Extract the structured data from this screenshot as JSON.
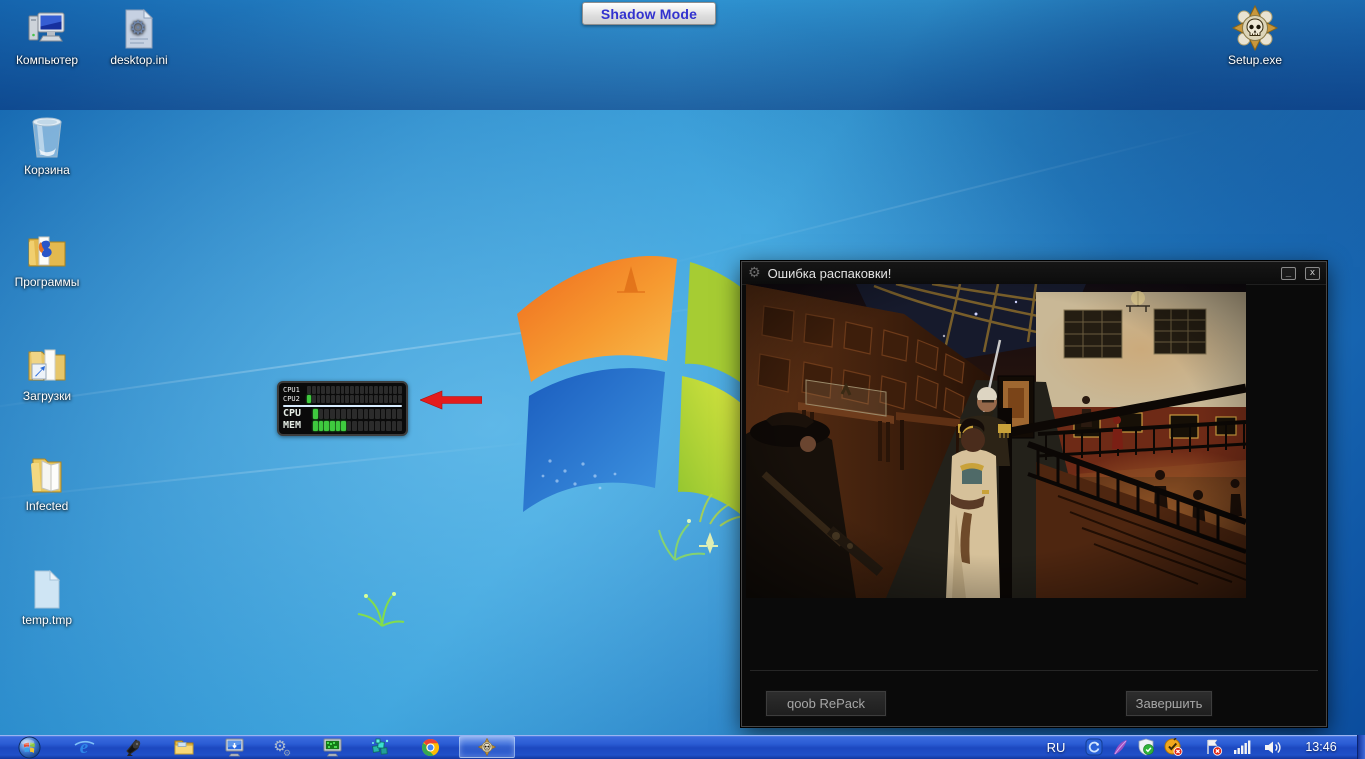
{
  "shadow_mode": {
    "label": "Shadow Mode",
    "text_color": "#3232cf"
  },
  "desktop_icons": [
    {
      "id": "computer",
      "label": "Компьютер",
      "icon": "computer-icon"
    },
    {
      "id": "desktop-ini",
      "label": "desktop.ini",
      "icon": "ini-file-gear-icon"
    },
    {
      "id": "recycle-bin",
      "label": "Корзина",
      "icon": "recycle-bin-icon"
    },
    {
      "id": "programs",
      "label": "Программы",
      "icon": "folder-programs-icon"
    },
    {
      "id": "downloads",
      "label": "Загрузки",
      "icon": "folder-shortcut-icon"
    },
    {
      "id": "infected",
      "label": "Infected",
      "icon": "folder-open-icon"
    },
    {
      "id": "temp-tmp",
      "label": "temp.tmp",
      "icon": "temp-file-icon"
    },
    {
      "id": "setup-exe",
      "label": "Setup.exe",
      "icon": "skull-emblem-icon"
    }
  ],
  "cpu_widget": {
    "rows": [
      {
        "label": "CPU1",
        "segments_total": 20,
        "segments_lit": 0
      },
      {
        "label": "CPU2",
        "segments_total": 20,
        "segments_lit": 1
      },
      {
        "label": "CPU",
        "segments_total": 16,
        "segments_lit": 1
      },
      {
        "label": "MEM",
        "segments_total": 16,
        "segments_lit": 6
      }
    ],
    "lit_color": "#3fca3f",
    "unlit_color": "#2b2b2b"
  },
  "error_window": {
    "title": "Ошибка распаковки!",
    "minimize_glyph": "_",
    "close_glyph": "x",
    "buttons": {
      "left": "qoob RePack",
      "right": "Завершить"
    },
    "content_image": "game-screenshot-museum-scene"
  },
  "taskbar": {
    "language_indicator": "RU",
    "clock": "13:46",
    "pinned_apps": [
      "start-orb",
      "internet-explorer",
      "audio-horn-app",
      "file-explorer",
      "remote-desktop-app",
      "gears-settings-app",
      "system-monitor-app",
      "teal-cubes-app",
      "chrome-browser",
      "skull-installer-active"
    ],
    "tray_icons": [
      "blue-dialer-app",
      "purple-feather-app",
      "antivirus-shield-check",
      "status-yellow-error",
      "action-center-flag-error",
      "network-signal",
      "volume-speaker"
    ]
  },
  "palette": {
    "desktop_blue": "#2f9bd9",
    "taskbar_blue": "#2a5cd4",
    "error_window_bg": "#0a0a0a",
    "meter_green": "#3fca3f",
    "arrow_red": "#e41c1c"
  }
}
